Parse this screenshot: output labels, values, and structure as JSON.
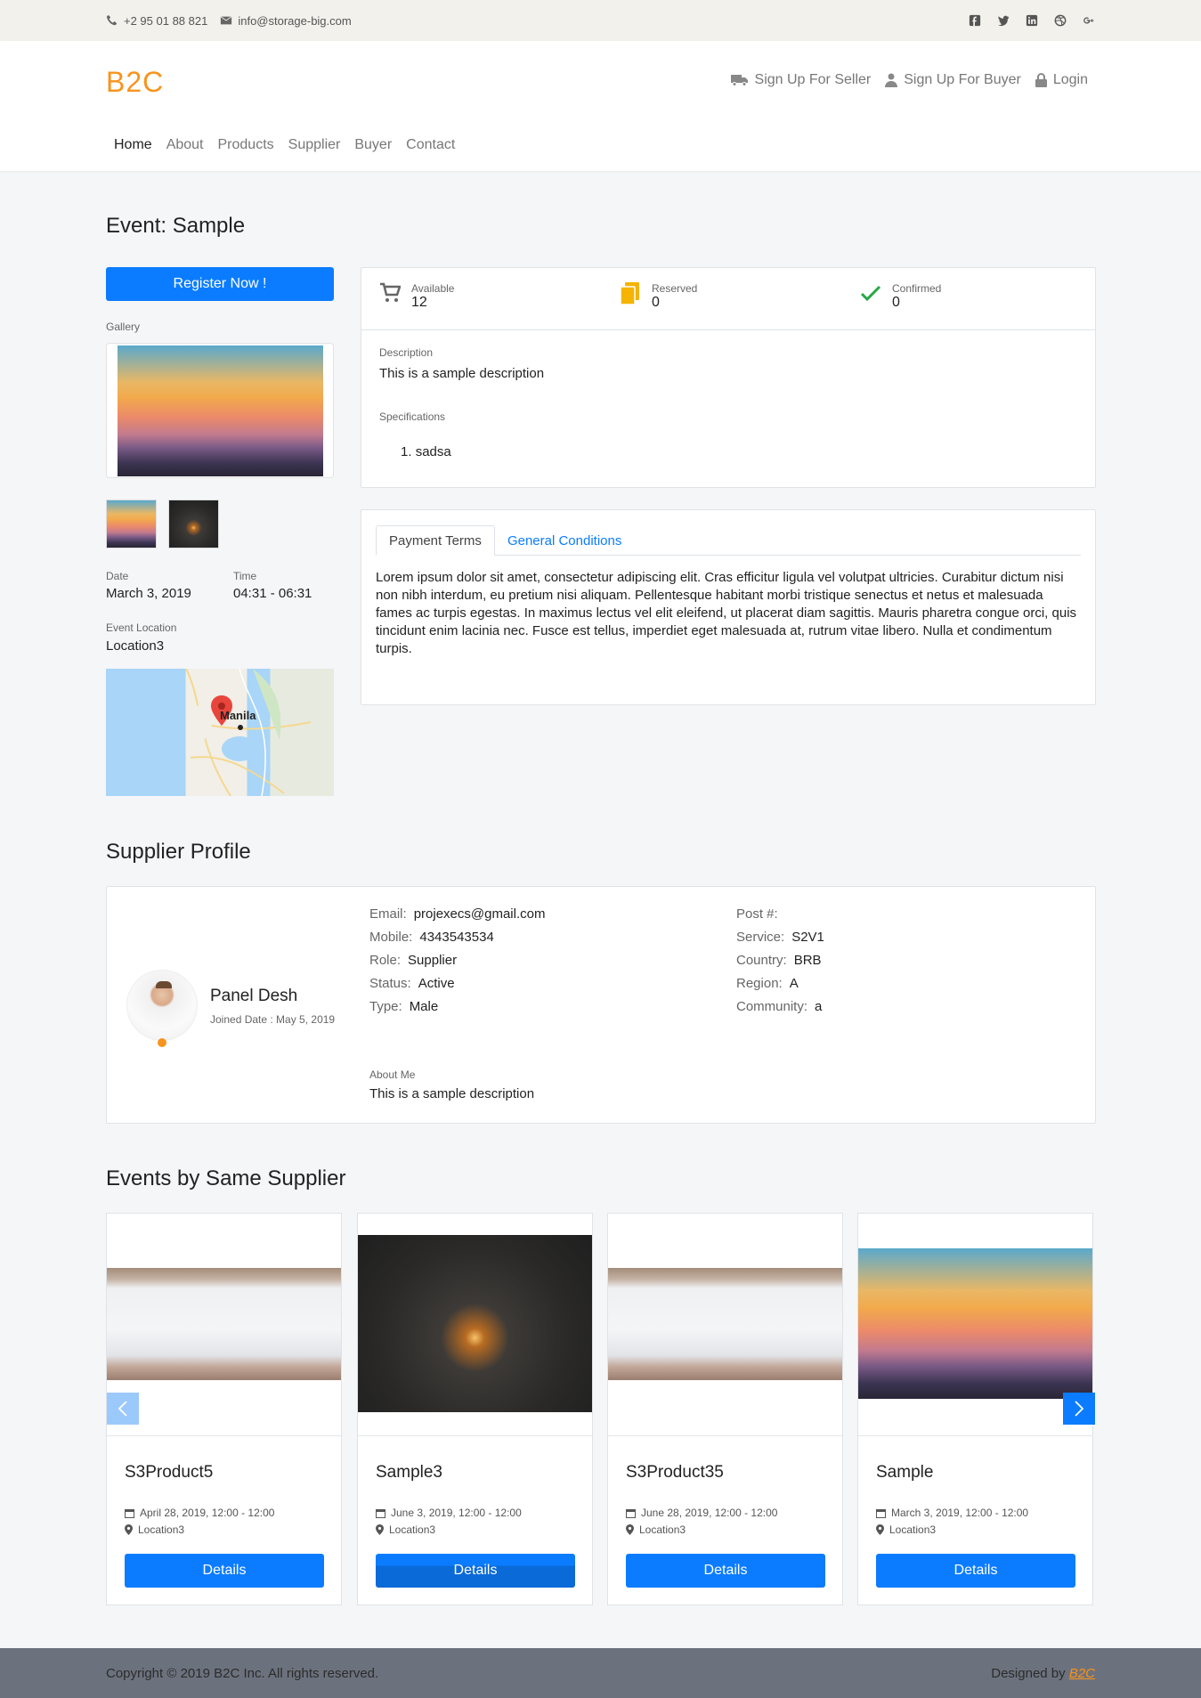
{
  "topbar": {
    "phone": "+2 95 01 88 821",
    "email": "info@storage-big.com",
    "social": [
      "facebook-icon",
      "twitter-icon",
      "linkedin-icon",
      "dribbble-icon",
      "google-plus-icon"
    ]
  },
  "header": {
    "brand": "B2C",
    "links": {
      "seller": "Sign Up For Seller",
      "buyer": "Sign Up For Buyer",
      "login": "Login"
    },
    "nav": [
      "Home",
      "About",
      "Products",
      "Supplier",
      "Buyer",
      "Contact"
    ]
  },
  "event": {
    "title": "Event: Sample",
    "register": "Register Now !",
    "gallery_label": "Gallery",
    "date_label": "Date",
    "date": "March 3, 2019",
    "time_label": "Time",
    "time": "04:31 - 06:31",
    "location_label": "Event Location",
    "location": "Location3",
    "map_city": "Manila",
    "stats": {
      "available_label": "Available",
      "available": "12",
      "reserved_label": "Reserved",
      "reserved": "0",
      "confirmed_label": "Confirmed",
      "confirmed": "0"
    },
    "description_label": "Description",
    "description": "This is a sample description",
    "specifications_label": "Specifications",
    "specifications": [
      "sadsa"
    ],
    "tabs": {
      "payment": "Payment Terms",
      "general": "General Conditions"
    },
    "lorem": "Lorem ipsum dolor sit amet, consectetur adipiscing elit. Cras efficitur ligula vel volutpat ultricies. Curabitur dictum nisi non nibh interdum, eu pretium nisi aliquam. Pellentesque habitant morbi tristique senectus et netus et malesuada fames ac turpis egestas. In maximus lectus vel elit eleifend, ut placerat diam sagittis. Mauris pharetra congue orci, quis tincidunt enim lacinia nec. Fusce est tellus, imperdiet eget malesuada at, rutrum vitae libero. Nulla et condimentum turpis."
  },
  "supplier": {
    "heading": "Supplier Profile",
    "name": "Panel Desh",
    "joined": "Joined Date : May 5, 2019",
    "email_label": "Email:",
    "email": "projexecs@gmail.com",
    "mobile_label": "Mobile:",
    "mobile": "4343543534",
    "role_label": "Role:",
    "role": "Supplier",
    "status_label": "Status:",
    "status": "Active",
    "type_label": "Type:",
    "type": "Male",
    "post_label": "Post #:",
    "post": "",
    "service_label": "Service:",
    "service": "S2V1",
    "country_label": "Country:",
    "country": "BRB",
    "region_label": "Region:",
    "region": "A",
    "community_label": "Community:",
    "community": "a",
    "about_label": "About Me",
    "about": "This is a sample description"
  },
  "related": {
    "heading": "Events by Same Supplier",
    "details_label": "Details",
    "events": [
      {
        "title": "S3Product5",
        "date": "April 28, 2019, 12:00 - 12:00",
        "location": "Location3"
      },
      {
        "title": "Sample3",
        "date": "June 3, 2019, 12:00 - 12:00",
        "location": "Location3"
      },
      {
        "title": "S3Product35",
        "date": "June 28, 2019, 12:00 - 12:00",
        "location": "Location3"
      },
      {
        "title": "Sample",
        "date": "March 3, 2019, 12:00 - 12:00",
        "location": "Location3"
      }
    ]
  },
  "footer": {
    "copyright": "Copyright © 2019 B2C Inc. All rights reserved.",
    "designed_by": "Designed by",
    "designer": "B2C"
  },
  "colors": {
    "accent": "#0b7cff",
    "brand": "#f7941d",
    "confirm": "#28a745",
    "reserved": "#f4b400"
  }
}
